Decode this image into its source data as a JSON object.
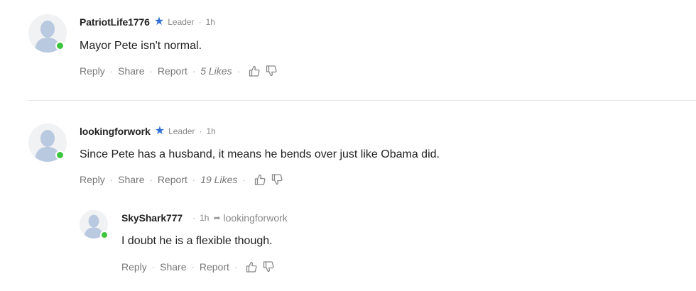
{
  "comments": [
    {
      "username": "PatriotLife1776",
      "badge": "Leader",
      "time": "1h",
      "body": "Mayor Pete isn't normal.",
      "actions": {
        "reply": "Reply",
        "share": "Share",
        "report": "Report",
        "likes": "5 Likes"
      }
    },
    {
      "username": "lookingforwork",
      "badge": "Leader",
      "time": "1h",
      "body": "Since Pete has a husband, it means he bends over just like Obama did.",
      "actions": {
        "reply": "Reply",
        "share": "Share",
        "report": "Report",
        "likes": "19 Likes"
      }
    },
    {
      "username": "SkyShark777",
      "time": "1h",
      "reply_to": "lookingforwork",
      "body": "I doubt he is a flexible though.",
      "actions": {
        "reply": "Reply",
        "share": "Share",
        "report": "Report"
      }
    }
  ],
  "separators": {
    "dot": "·"
  },
  "icons": {
    "leader_badge": "star-icon",
    "reply_to": "reply-arrow-icon",
    "like": "thumbs-up-icon",
    "dislike": "thumbs-down-icon",
    "avatar": "default-avatar-icon"
  },
  "colors": {
    "badge_star": "#2f6fd6",
    "online": "#3ec43e",
    "avatar_figure": "#b9c9e0"
  }
}
